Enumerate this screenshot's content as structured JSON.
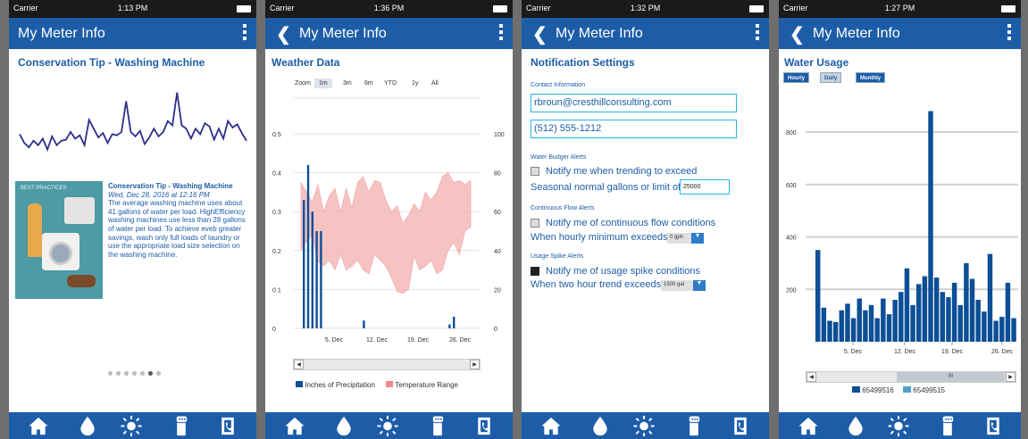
{
  "status": {
    "carrier": "Carrier",
    "times": [
      "1:13 PM",
      "1:36 PM",
      "1:32 PM",
      "1:27 PM"
    ]
  },
  "app_title": "My Meter Info",
  "screen1": {
    "heading": "Conservation Tip - Washing Machine",
    "card_title": "Conservation Tip - Washing Machine",
    "card_date": "Wed, Dec 28, 2016 at 12:16 PM",
    "card_body": "The average washing machine uses about 41 gallons of water per load. HighEfficiency washing machines use less than 28 gallons of water per load. To achieve eveb greater savings, wash only full loads of laundry or use the appropriate load size selection on the washing machine.",
    "image_label": "BEST PRACTICES",
    "pager": {
      "count": 7,
      "active_index": 5
    }
  },
  "screen2": {
    "heading": "Weather Data",
    "zoom_label": "Zoom",
    "zoom_options": [
      "1m",
      "3m",
      "6m",
      "YTD",
      "1y",
      "All"
    ],
    "zoom_selected": "1m",
    "legend": [
      "Inches of Precipitation",
      "Temperature Range"
    ]
  },
  "screen3": {
    "heading": "Notification Settings",
    "contact_label": "Contact Information",
    "email_value": "rbroun@cresthillconsulting.com",
    "phone_value": "(512) 555-1212",
    "water_budget_label": "Water Budger Alerts",
    "water_budget_check": "Notify me when trending to exceed",
    "seasonal_text": "Seasonal normal gallons or limit of",
    "seasonal_value": "25000",
    "continuous_label": "Continuous Flow Alerts",
    "continuous_check": "Notify me of continuous flow conditions",
    "hourly_text": "When hourly minimum exceeds",
    "hourly_value": "0 gph",
    "spike_label": "Usage Spike Alerts",
    "spike_check": "Notify me of usage spike conditions",
    "spike_text": "When two hour trend exceeds",
    "spike_value": "1500 gal",
    "checks": {
      "water_budget": false,
      "continuous": false,
      "spike": true
    }
  },
  "screen4": {
    "heading": "Water Usage",
    "buttons": [
      "Hourly",
      "Daily",
      "Monthly"
    ],
    "selected": "Daily",
    "legend": [
      "65499516",
      "65499515"
    ],
    "scroll_thumb_label": "III"
  },
  "colors": {
    "brand": "#1d5da8",
    "bar": "#0d4f96",
    "temp": "#f08a8a",
    "line": "#2e2e8a"
  },
  "chart_data": [
    {
      "type": "line",
      "title": "",
      "values": [
        50,
        42,
        38,
        44,
        40,
        46,
        36,
        48,
        40,
        44,
        45,
        52,
        46,
        49,
        40,
        63,
        55,
        47,
        51,
        42,
        50,
        49,
        52,
        80,
        52,
        48,
        53,
        41,
        47,
        55,
        48,
        52,
        62,
        58,
        88,
        58,
        55,
        46,
        55,
        50,
        60,
        57,
        45,
        55,
        46,
        62,
        56,
        59,
        51,
        44
      ]
    },
    {
      "type": "bar",
      "title": "",
      "x_ticks": [
        "5. Dec",
        "12. Dec",
        "19. Dec",
        "26. Dec"
      ],
      "y_left_ticks": [
        "0",
        "0.1",
        "0.2",
        "0.3",
        "0.4",
        "0.5"
      ],
      "y_right_ticks": [
        "0",
        "20",
        "40",
        "60",
        "80",
        "100"
      ],
      "ylim": [
        0,
        0.5
      ],
      "y2lim": [
        0,
        100
      ],
      "series": [
        {
          "name": "Inches of Precipitation",
          "values": [
            0.33,
            0.42,
            0.3,
            0.25,
            0.25,
            0.0,
            0.0,
            0.0,
            0.0,
            0.0,
            0.0,
            0.0,
            0.0,
            0.0,
            0.02,
            0.0,
            0.0,
            0.0,
            0.0,
            0.0,
            0.0,
            0.0,
            0.0,
            0.0,
            0.0,
            0.0,
            0.0,
            0.0,
            0.0,
            0.0,
            0.0,
            0.0,
            0.0,
            0.0,
            0.01,
            0.03
          ]
        },
        {
          "name": "Temperature Range",
          "low": [
            40,
            45,
            48,
            34,
            32,
            35,
            30,
            38,
            30,
            32,
            35,
            30,
            28,
            38,
            35,
            32,
            26,
            19,
            18,
            20,
            37,
            30,
            32,
            35,
            28,
            30,
            40,
            44,
            38,
            50,
            52
          ],
          "high": [
            75,
            70,
            65,
            74,
            60,
            68,
            72,
            60,
            72,
            62,
            75,
            78,
            70,
            76,
            75,
            66,
            60,
            63,
            54,
            58,
            64,
            60,
            70,
            66,
            70,
            78,
            80,
            75,
            76,
            74,
            76
          ]
        }
      ]
    },
    {
      "type": "bar",
      "title": "",
      "x_ticks": [
        "5. Dec",
        "12. Dec",
        "19. Dec",
        "26. Dec"
      ],
      "y_ticks": [
        "200",
        "400",
        "600",
        "800"
      ],
      "ylim": [
        0,
        960
      ],
      "series": [
        {
          "name": "65499516",
          "values": [
            350,
            130,
            80,
            75,
            120,
            145,
            90,
            165,
            120,
            140,
            90,
            165,
            105,
            160,
            190,
            280,
            140,
            220,
            250,
            880,
            245,
            190,
            170,
            225,
            140,
            300,
            240,
            160,
            115,
            335,
            80,
            95,
            225,
            90
          ]
        }
      ]
    }
  ]
}
